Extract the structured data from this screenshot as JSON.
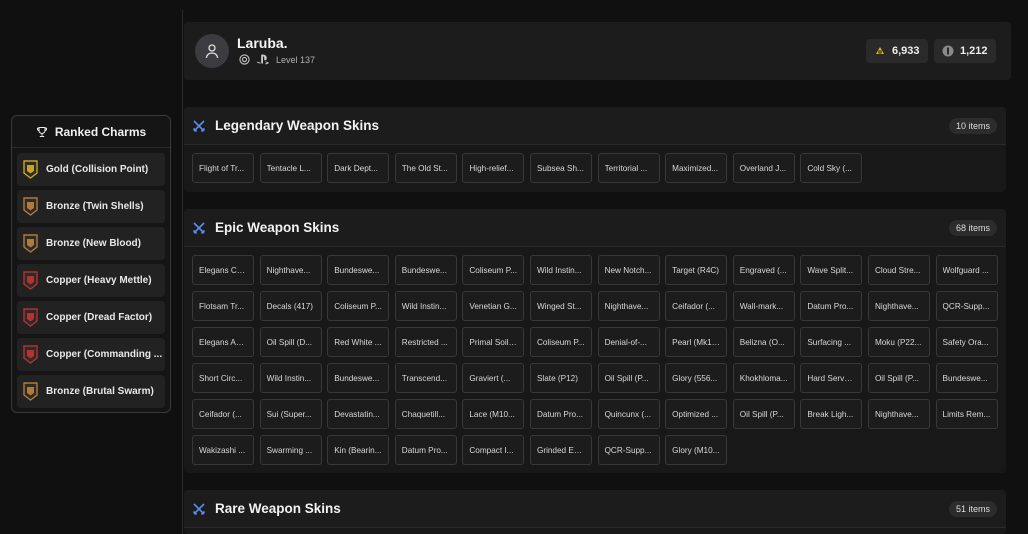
{
  "profile": {
    "name": "Laruba.",
    "level": "Level 137",
    "currency_1": "6,933",
    "currency_2": "1,212"
  },
  "charms": {
    "title": "Ranked Charms",
    "items": [
      {
        "label": "Gold (Collision Point)",
        "tier": "gold"
      },
      {
        "label": "Bronze (Twin Shells)",
        "tier": "bronze"
      },
      {
        "label": "Bronze (New Blood)",
        "tier": "bronze"
      },
      {
        "label": "Copper (Heavy Mettle)",
        "tier": "copper"
      },
      {
        "label": "Copper (Dread Factor)",
        "tier": "copper"
      },
      {
        "label": "Copper (Commanding ...",
        "tier": "copper"
      },
      {
        "label": "Bronze (Brutal Swarm)",
        "tier": "bronze"
      }
    ]
  },
  "sections": [
    {
      "title": "Legendary Weapon Skins",
      "count": "10 items",
      "items": [
        "Flight of Tr...",
        "Tentacle L...",
        "Dark Dept...",
        "The Old St...",
        "High-relief...",
        "Subsea Sh...",
        "Territorial ...",
        "Maximized...",
        "Overland J...",
        "Cold Sky (..."
      ]
    },
    {
      "title": "Epic Weapon Skins",
      "count": "68 items",
      "items": [
        "Elegans Ca...",
        "Nighthave...",
        "Bundeswe...",
        "Bundeswe...",
        "Coliseum P...",
        "Wild Instin...",
        "New Notch...",
        "Target (R4C)",
        "Engraved (...",
        "Wave Split...",
        "Cloud Stre...",
        "Wolfguard ...",
        "Flotsam Tr...",
        "Decals (417)",
        "Coliseum P...",
        "Wild Instin...",
        "Venetian G...",
        "Winged St...",
        "Nighthave...",
        "Ceifador (...",
        "Wall-mark...",
        "Datum Pro...",
        "Nighthave...",
        "QCR-Supp...",
        "Elegans Au...",
        "Oil Spill (D...",
        "Red White ...",
        "Restricted ...",
        "Primal Soil ...",
        "Coliseum P...",
        "Denial-of-...",
        "Pearl (Mk1 ...",
        "Belizna (O...",
        "Surfacing ...",
        "Moku (P22...",
        "Safety Ora...",
        "Short Circ...",
        "Wild Instin...",
        "Bundeswe...",
        "Transcend...",
        "Graviert (...",
        "Slate (P12)",
        "Oil Spill (P...",
        "Glory (556...",
        "Khokhloma...",
        "Hard Serve...",
        "Oil Spill (P...",
        "Bundeswe...",
        "Ceifador (...",
        "Sui (Super...",
        "Devastatin...",
        "Chaquetill...",
        "Lace (M10...",
        "Datum Pro...",
        "Quincunx (...",
        "Optimized ...",
        "Oil Spill (P...",
        "Break Ligh...",
        "Nighthave...",
        "Limits Rem...",
        "Wakizashi ...",
        "Swarming ...",
        "Kin (Bearin...",
        "Datum Pro...",
        "Compact I...",
        "Grinded Ed...",
        "QCR-Supp...",
        "Glory (M10..."
      ]
    },
    {
      "title": "Rare Weapon Skins",
      "count": "51 items",
      "items": []
    }
  ],
  "colors": {
    "accent_icon": "#5b8def",
    "gold": "#c9a227",
    "bronze": "#b07a3a",
    "copper": "#b2332f"
  }
}
